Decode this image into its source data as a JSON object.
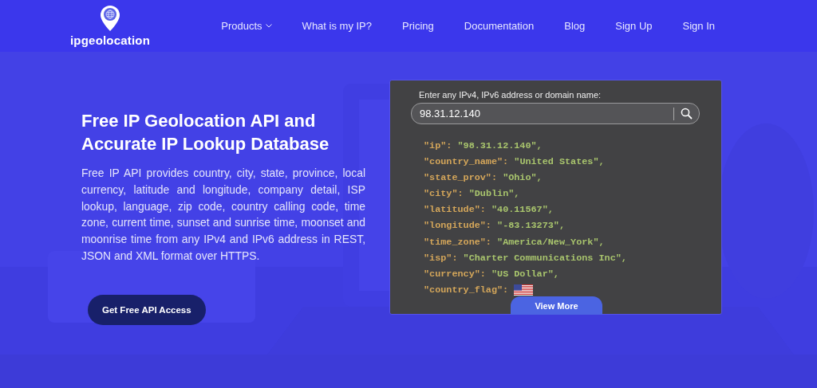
{
  "logo": {
    "text": "ipgeolocation"
  },
  "nav": [
    {
      "label": "Products",
      "dropdown": true
    },
    {
      "label": "What is my IP?",
      "dropdown": false
    },
    {
      "label": "Pricing",
      "dropdown": false
    },
    {
      "label": "Documentation",
      "dropdown": false
    },
    {
      "label": "Blog",
      "dropdown": false
    },
    {
      "label": "Sign Up",
      "dropdown": false
    },
    {
      "label": "Sign In",
      "dropdown": false
    }
  ],
  "hero": {
    "title": "Free IP Geolocation API and Accurate IP Lookup Database",
    "description": "Free IP API provides country, city, state, province, local currency, latitude and longitude, company detail, ISP lookup, language, zip code, country calling code, time zone, current time, sunset and sunrise time, moonset and moonrise time from any IPv4 and IPv6 address in REST, JSON and XML format over HTTPS.",
    "cta": "Get Free API Access"
  },
  "lookup": {
    "label": "Enter any IPv4, IPv6 address or domain name:",
    "value": "98.31.12.140",
    "lines": [
      {
        "key": "\"ip\":",
        "kind": "text",
        "value": "\"98.31.12.140\","
      },
      {
        "key": "\"country_name\":",
        "kind": "text",
        "value": "\"United States\","
      },
      {
        "key": "\"state_prov\":",
        "kind": "text",
        "value": "\"Ohio\","
      },
      {
        "key": "\"city\":",
        "kind": "text",
        "value": "\"Dublin\","
      },
      {
        "key": "\"latitude\":",
        "kind": "text",
        "value": "\"40.11567\","
      },
      {
        "key": "\"longitude\":",
        "kind": "text",
        "value": "\"-83.13273\","
      },
      {
        "key": "\"time_zone\":",
        "kind": "text",
        "value": "\"America/New_York\","
      },
      {
        "key": "\"isp\":",
        "kind": "text",
        "value": "\"Charter Communications Inc\","
      },
      {
        "key": "\"currency\":",
        "kind": "text",
        "value": "\"US Dollar\","
      },
      {
        "key": "\"country_flag\":",
        "kind": "flag"
      }
    ],
    "more_button": "View More"
  }
}
